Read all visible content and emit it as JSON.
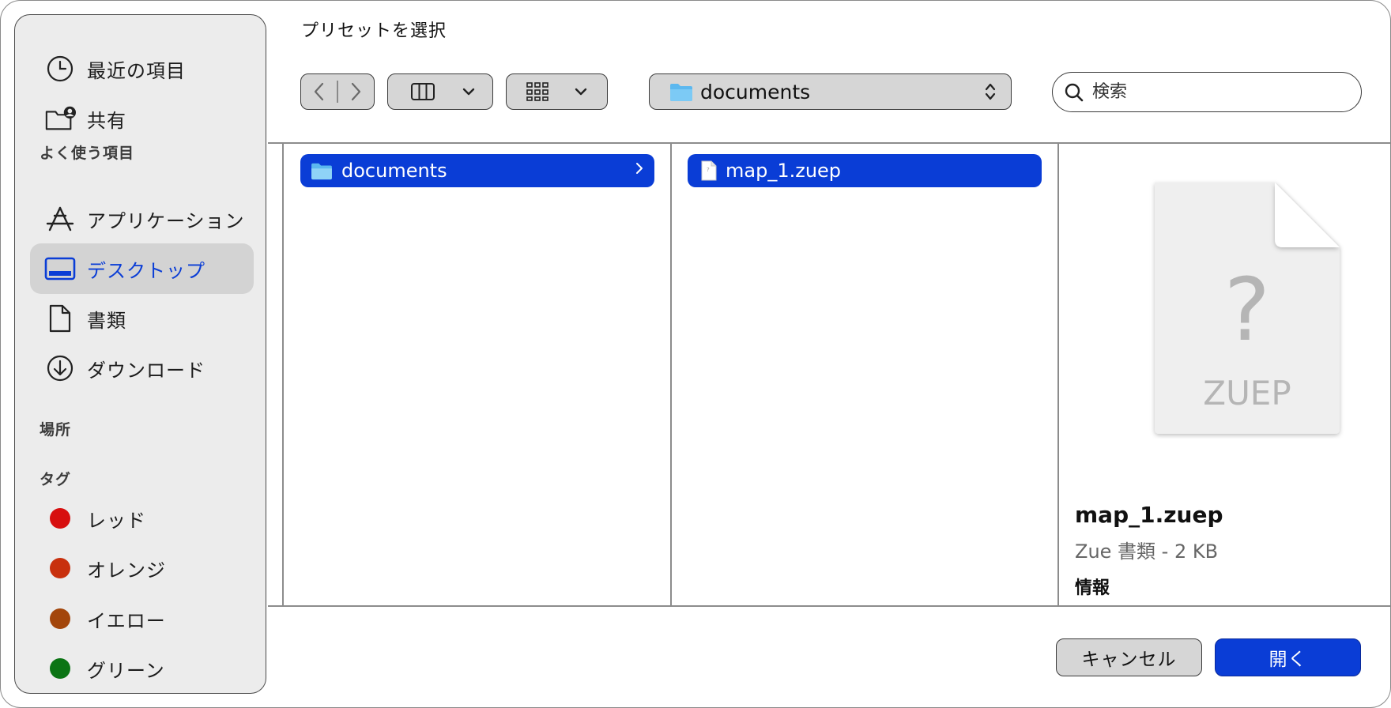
{
  "dialog": {
    "title": "プリセットを選択"
  },
  "sidebar": {
    "recents": [
      {
        "label": "最近の項目",
        "icon": "clock-icon"
      },
      {
        "label": "共有",
        "icon": "shared-folder-icon"
      }
    ],
    "favorites_header": "よく使う項目",
    "favorites": [
      {
        "label": "アプリケーション",
        "icon": "applications-icon"
      },
      {
        "label": "デスクトップ",
        "icon": "desktop-icon",
        "selected": true
      },
      {
        "label": "書類",
        "icon": "document-icon"
      },
      {
        "label": "ダウンロード",
        "icon": "download-icon"
      }
    ],
    "locations_header": "場所",
    "tags_header": "タグ",
    "tags": [
      {
        "label": "レッド",
        "color": "#d70f0f"
      },
      {
        "label": "オレンジ",
        "color": "#c8300d"
      },
      {
        "label": "イエロー",
        "color": "#a3460b"
      },
      {
        "label": "グリーン",
        "color": "#0b7414"
      }
    ]
  },
  "toolbar": {
    "back_icon": "chevron-left-icon",
    "forward_icon": "chevron-right-icon",
    "view_icon": "columns-view-icon",
    "group_icon": "grid-icon",
    "path_label": "documents",
    "search_placeholder": "検索"
  },
  "browser": {
    "column1_item": "documents",
    "column2_item": "map_1.zuep"
  },
  "preview": {
    "icon_ext": "ZUEP",
    "icon_glyph": "?",
    "file_name": "map_1.zuep",
    "file_meta": "Zue 書類 - 2 KB",
    "info_label": "情報"
  },
  "buttons": {
    "cancel": "キャンセル",
    "open": "開く"
  },
  "colors": {
    "accent": "#0a3dd6",
    "sidebar_bg": "#ececec"
  }
}
